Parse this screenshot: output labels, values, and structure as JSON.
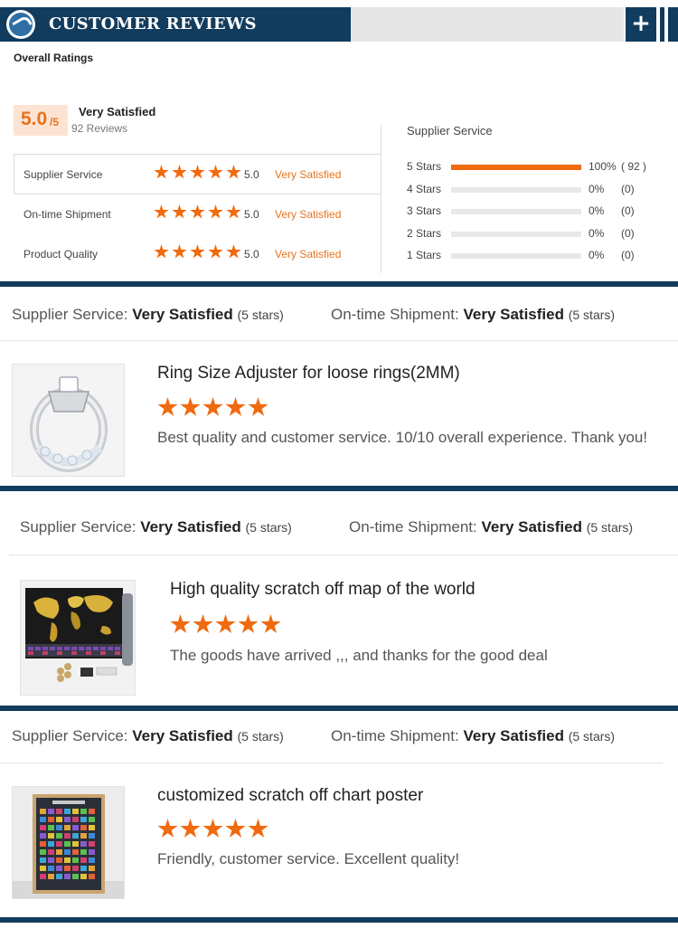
{
  "header": {
    "title": "CUSTOMER REVIEWS",
    "plus_label": "+"
  },
  "overall": {
    "label": "Overall Ratings",
    "score": "5.0",
    "score_suffix": "/5",
    "verdict": "Very Satisfied",
    "reviews": "92 Reviews"
  },
  "ratings": [
    {
      "label": "Supplier Service",
      "stars": 5,
      "value": "5.0",
      "verdict": "Very Satisfied"
    },
    {
      "label": "On-time Shipment",
      "stars": 5,
      "value": "5.0",
      "verdict": "Very Satisfied"
    },
    {
      "label": "Product Quality",
      "stars": 5,
      "value": "5.0",
      "verdict": "Very Satisfied"
    }
  ],
  "distribution": {
    "title": "Supplier Service",
    "rows": [
      {
        "label": "5 Stars",
        "fraction": 1.0,
        "pct": "100%",
        "count": "( 92 )"
      },
      {
        "label": "4 Stars",
        "fraction": 0,
        "pct": "0%",
        "count": "(0)"
      },
      {
        "label": "3 Stars",
        "fraction": 0,
        "pct": "0%",
        "count": "(0)"
      },
      {
        "label": "2 Stars",
        "fraction": 0,
        "pct": "0%",
        "count": "(0)"
      },
      {
        "label": "1 Stars",
        "fraction": 0,
        "pct": "0%",
        "count": "(0)"
      }
    ]
  },
  "reviews": [
    {
      "supplier_label": "Supplier Service:",
      "supplier_value": "Very Satisfied",
      "supplier_stars": "(5 stars)",
      "shipment_label": "On-time Shipment:",
      "shipment_value": "Very Satisfied",
      "shipment_stars": "(5 stars)",
      "title": "Ring Size Adjuster for loose rings(2MM)",
      "stars": 5,
      "text": "Best quality and customer service. 10/10 overall experience. Thank you!",
      "image": "ring-adjuster-photo"
    },
    {
      "supplier_label": "Supplier Service:",
      "supplier_value": "Very Satisfied",
      "supplier_stars": "(5 stars)",
      "shipment_label": "On-time Shipment:",
      "shipment_value": "Very Satisfied",
      "shipment_stars": "(5 stars)",
      "title": "High quality scratch off map of the world",
      "stars": 5,
      "text": "The goods have arrived ,,, and thanks for the good deal",
      "image": "scratch-map-photo"
    },
    {
      "supplier_label": "Supplier Service:",
      "supplier_value": "Very Satisfied",
      "supplier_stars": "(5 stars)",
      "shipment_label": "On-time Shipment:",
      "shipment_value": "Very Satisfied",
      "shipment_stars": "(5 stars)",
      "title": "customized scratch off chart poster",
      "stars": 5,
      "text": "Friendly, customer service. Excellent quality!",
      "image": "chart-poster-photo"
    }
  ],
  "colors": {
    "navy": "#123c5e",
    "accent": "#f06a0f",
    "score_bg": "#fde3d3"
  }
}
